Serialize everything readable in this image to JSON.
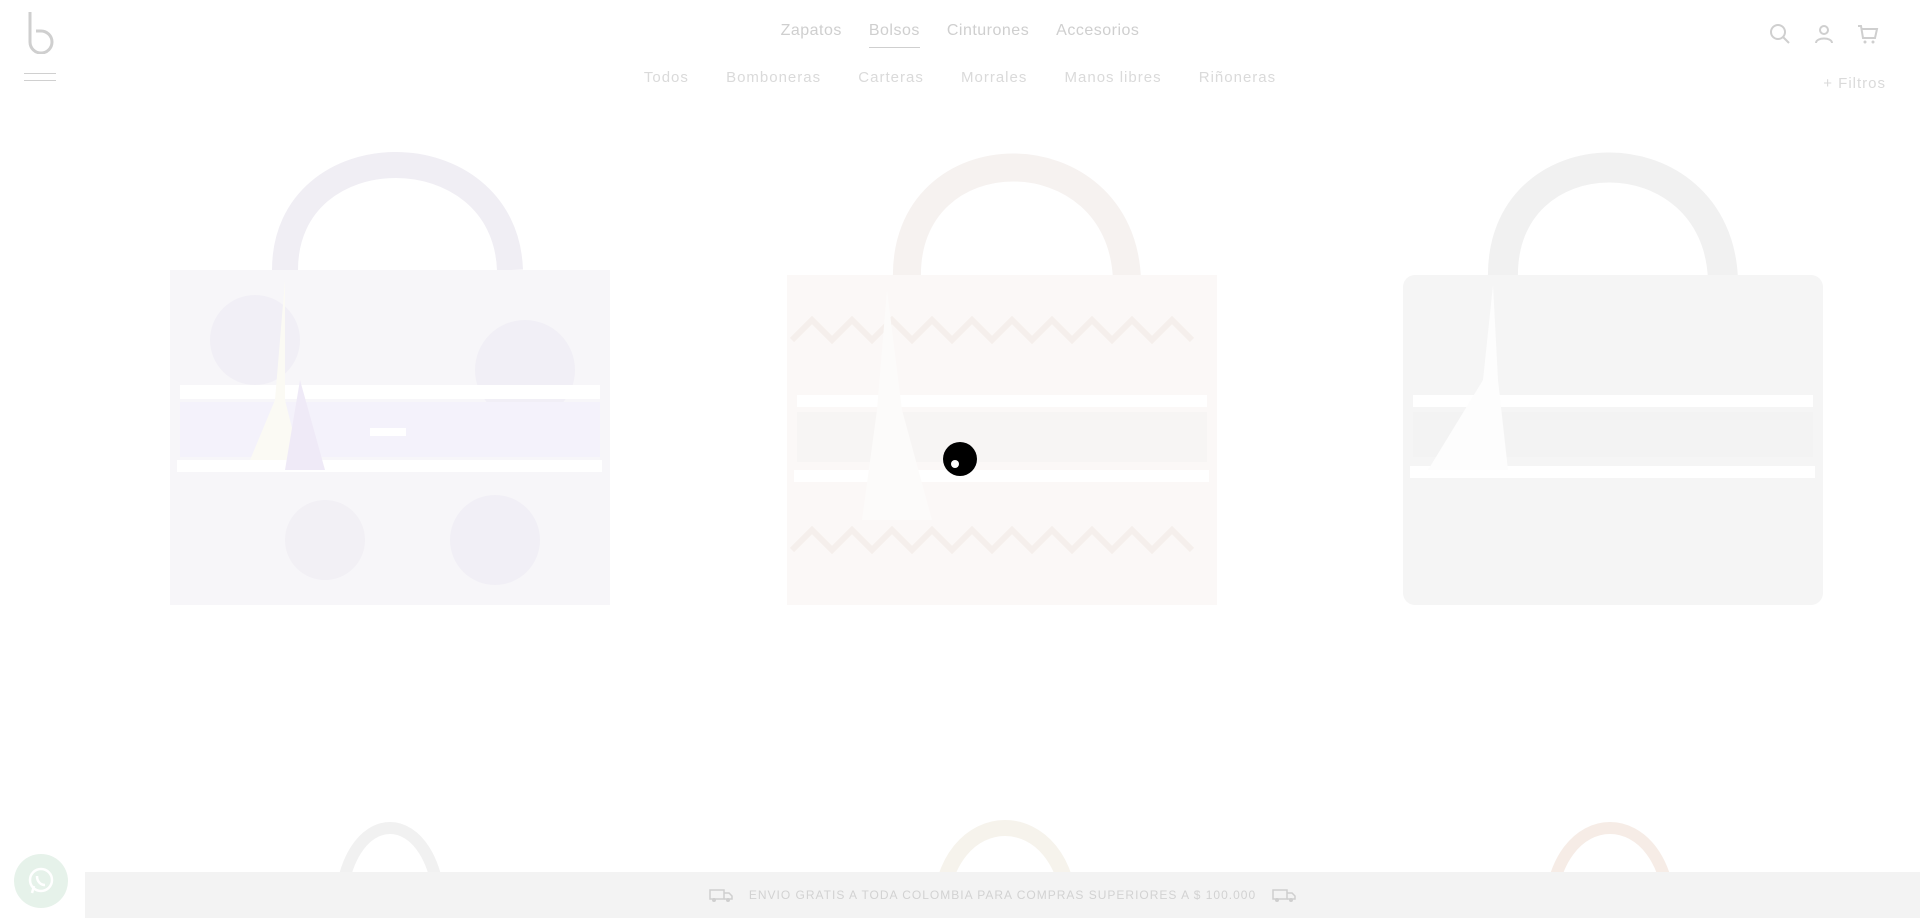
{
  "header": {
    "logo_icon": "brand-b-logo",
    "menu_icon": "hamburger-menu-icon",
    "nav": [
      {
        "label": "Zapatos",
        "active": false
      },
      {
        "label": "Bolsos",
        "active": true
      },
      {
        "label": "Cinturones",
        "active": false
      },
      {
        "label": "Accesorios",
        "active": false
      }
    ],
    "icons": [
      "search-icon",
      "user-icon",
      "cart-icon"
    ]
  },
  "subnav": [
    {
      "label": "Todos"
    },
    {
      "label": "Bomboneras"
    },
    {
      "label": "Carteras"
    },
    {
      "label": "Morrales"
    },
    {
      "label": "Manos libres"
    },
    {
      "label": "Riñoneras"
    }
  ],
  "filters": {
    "label": "+ Filtros"
  },
  "products": [
    {
      "pattern": "floral",
      "accent": "#b8a8e8"
    },
    {
      "pattern": "zigzag",
      "accent": "#e8a0a0"
    },
    {
      "pattern": "lattice",
      "accent": "#c8c8c8"
    },
    {
      "pattern": "plain",
      "accent": "#e0e0e0"
    },
    {
      "pattern": "plain",
      "accent": "#e8e0c8"
    },
    {
      "pattern": "plain",
      "accent": "#e8b8a0"
    }
  ],
  "shipping": {
    "text": "ENVIO GRATIS A TODA COLOMBIA PARA COMPRAS SUPERIORES A $ 100.000",
    "icon": "truck-icon"
  },
  "whatsapp": {
    "icon": "whatsapp-icon"
  },
  "colors": {
    "overlay": "#ffffff",
    "loader": "#000000",
    "bar": "#f3f3f3"
  }
}
